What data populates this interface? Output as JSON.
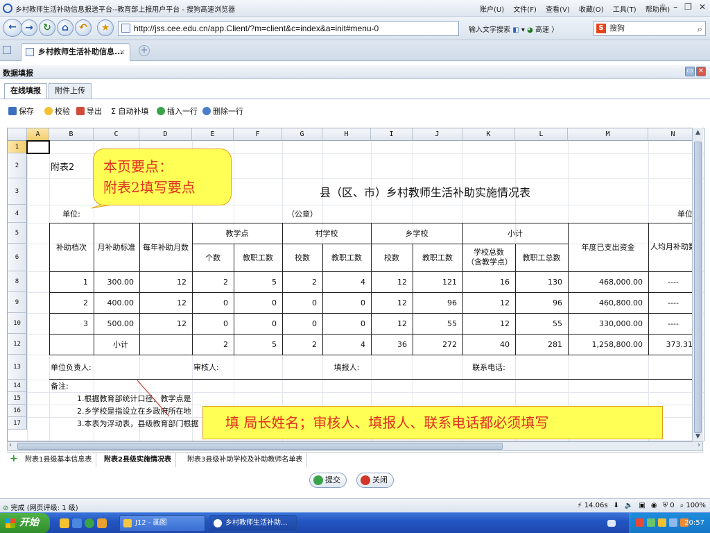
{
  "window": {
    "title": "乡村教师生活补助信息报送平台--教育部上报用户平台 - 搜狗高速浏览器",
    "menus": [
      "账户(U)",
      "文件(F)",
      "查看(V)",
      "收藏(O)",
      "工具(T)",
      "帮助(H)"
    ]
  },
  "nav": {
    "url": "http://jss.cee.edu.cn/app.Client/?m=client&c=index&a=init#menu-0",
    "input_hint": "输入文字搜索",
    "speed": "高速",
    "search_placeholder": "搜狗"
  },
  "tab": {
    "label": "乡村教师生活补助信息..."
  },
  "panel": {
    "title": "数据填报",
    "subtabs": [
      "在线填报",
      "附件上传"
    ],
    "toolbar": [
      "保存",
      "校验",
      "导出",
      "Σ 自动补填",
      "插入一行",
      "删除一行"
    ]
  },
  "sheet": {
    "columns": [
      "A",
      "B",
      "C",
      "D",
      "E",
      "F",
      "G",
      "H",
      "I",
      "J",
      "K",
      "L",
      "M",
      "N"
    ],
    "rows": [
      "1",
      "2",
      "3",
      "4",
      "5",
      "6",
      "8",
      "9",
      "10",
      "12",
      "13",
      "14",
      "15",
      "16",
      "17"
    ],
    "label_attach": "附表2",
    "title": "县（区、市）乡村教师生活补助实施情况表",
    "unit_label": "单位:",
    "seal_label": "（公章）",
    "unit_right": "单位",
    "headers": {
      "level": "补助档次",
      "monthly_std": "月补助标准",
      "months_per_year": "每年补助月数",
      "teaching_point": "教学点",
      "village_school": "村学校",
      "town_school": "乡学校",
      "subtotal_group": "小计",
      "count": "个数",
      "staff": "教职工数",
      "schools": "校数",
      "staff2": "教职工数",
      "schools2": "校数",
      "staff3": "教职工数",
      "total_schools": "学校总数（含教学点）",
      "total_staff": "教职工总数",
      "spent": "年度已支出资金",
      "per_capita": "人均月补助数"
    },
    "data_rows": [
      [
        "1",
        "300.00",
        "12",
        "2",
        "5",
        "2",
        "4",
        "12",
        "121",
        "16",
        "130",
        "468,000.00",
        "----"
      ],
      [
        "2",
        "400.00",
        "12",
        "0",
        "0",
        "0",
        "0",
        "12",
        "96",
        "12",
        "96",
        "460,800.00",
        "----"
      ],
      [
        "3",
        "500.00",
        "12",
        "0",
        "0",
        "0",
        "0",
        "12",
        "55",
        "12",
        "55",
        "330,000.00",
        "----"
      ]
    ],
    "subtotal": {
      "label": "小计",
      "values": [
        "2",
        "5",
        "2",
        "4",
        "36",
        "272",
        "40",
        "281",
        "1,258,800.00",
        "373.31"
      ]
    },
    "signoff": {
      "unit_head": "单位负责人:",
      "reviewer": "审核人:",
      "filler": "填报人:",
      "phone": "联系电话:"
    },
    "notes_label": "备注:",
    "notes": [
      "1.根据教育部统计口径，教学点是",
      "2.乡学校是指设立在乡政府所在地",
      "3.本表为浮动表，县级教育部门根据"
    ]
  },
  "callouts": {
    "top_line1": "本页要点：",
    "top_line2": "附表2填写要点",
    "bottom": "填  局长姓名；审核人、填报人、联系电话都必须填写"
  },
  "sheet_tabs": [
    "附表1县级基本信息表",
    "附表2县级实施情况表",
    "附表3县级补助学校及补助教师名单表"
  ],
  "footer": {
    "submit": "提交",
    "close": "关闭"
  },
  "status": {
    "left": "完成 (网页评级: 1 级)",
    "time": "14.06s",
    "zoom": "100%",
    "count": "0"
  },
  "taskbar": {
    "start": "开始",
    "task1": "J12 - 画图",
    "task2": "乡村教师生活补助...",
    "clock": "20:57"
  },
  "colors": {
    "callout_bg": "#ffff55",
    "callout_text": "#e03020",
    "taskbar": "#2356c2"
  }
}
